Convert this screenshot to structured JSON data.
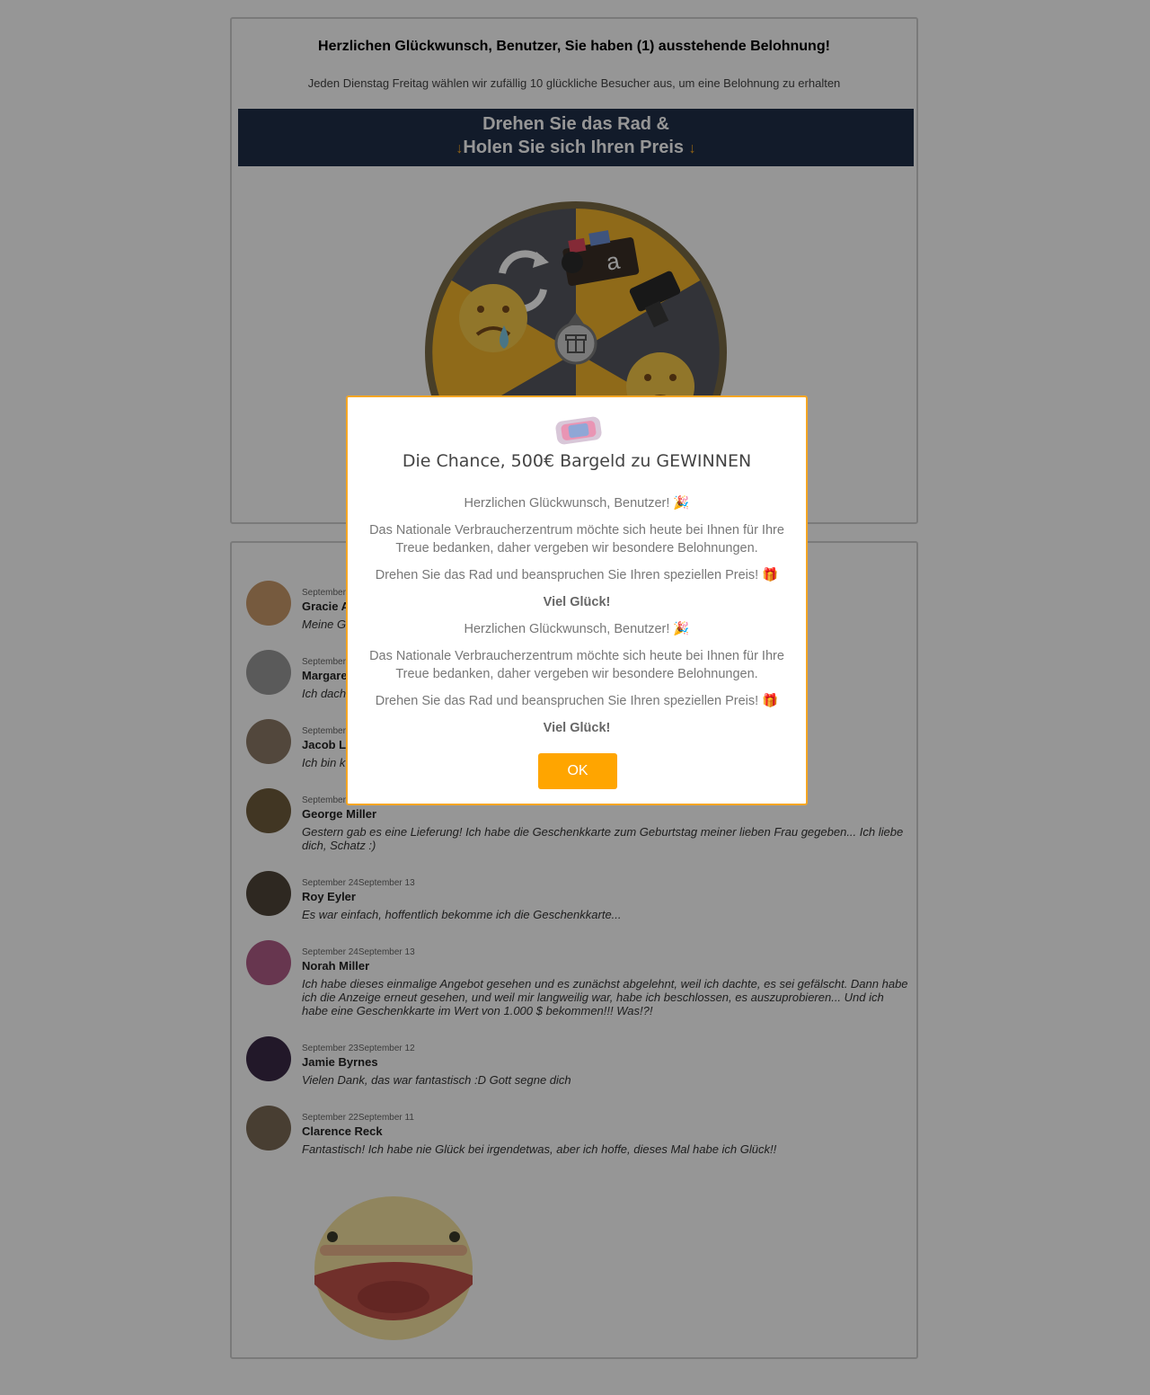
{
  "header": {
    "headline": "Herzlichen Glückwunsch, Benutzer, Sie haben (1) ausstehende Belohnung!",
    "subline": "Jeden Dienstag Freitag wählen wir zufällig 10 glückliche Besucher aus, um eine Belohnung zu erhalten",
    "banner_line1": "Drehen Sie das Rad &",
    "banner_line2": "Holen Sie sich Ihren Preis",
    "banner_arrow": "↓"
  },
  "wheel": {
    "segments": [
      "refresh-icon",
      "amazon-gift-box",
      "camera",
      "sad-emoji",
      "shield",
      "sad-emoji"
    ],
    "colors": {
      "gray": "#55585f",
      "yellow": "#f3b42c",
      "rim": "#7a6a45"
    },
    "center_icon": "gift-icon"
  },
  "comments": [
    {
      "date": "September 24September 13",
      "name": "Gracie A",
      "text": "Meine G",
      "avatar": "#c99a6a"
    },
    {
      "date": "September 24September 13",
      "name": "Margare",
      "text": "Ich dach ... er Post. #echt",
      "avatar": "#9a9a9a"
    },
    {
      "date": "September 24September 13",
      "name": "Jacob L",
      "text": "Ich bin k",
      "avatar": "#8c7a66"
    },
    {
      "date": "September 24September 13",
      "name": "George Miller",
      "text": "Gestern gab es eine Lieferung! Ich habe die Geschenkkarte zum Geburtstag meiner lieben Frau gegeben... Ich liebe dich, Schatz :)",
      "avatar": "#6f5c3c"
    },
    {
      "date": "September 24September 13",
      "name": "Roy Eyler",
      "text": "Es war einfach, hoffentlich bekomme ich die Geschenkkarte...",
      "avatar": "#4e4438"
    },
    {
      "date": "September 24September 13",
      "name": "Norah Miller",
      "text": "Ich habe dieses einmalige Angebot gesehen und es zunächst abgelehnt, weil ich dachte, es sei gefälscht. Dann habe ich die Anzeige erneut gesehen, und weil mir langweilig war, habe ich beschlossen, es auszuprobieren... Und ich habe eine Geschenkkarte im Wert von 1.000 $ bekommen!!! Was!?!",
      "avatar": "#b05c86"
    },
    {
      "date": "September 23September 12",
      "name": "Jamie Byrnes",
      "text": "Vielen Dank, das war fantastisch :D Gott segne dich",
      "avatar": "#3a2a46"
    },
    {
      "date": "September 22September 11",
      "name": "Clarence Reck",
      "text": "Fantastisch! Ich habe nie Glück bei irgendetwas, aber ich hoffe, dieses Mal habe ich Glück!!",
      "avatar": "#7b6a56"
    }
  ],
  "modal": {
    "title": "Die Chance, 500€ Bargeld zu GEWINNEN",
    "para1": "Herzlichen Glückwunsch, Benutzer! 🎉",
    "para2": "Das Nationale Verbraucherzentrum möchte sich heute bei Ihnen für Ihre Treue bedanken, daher vergeben wir besondere Belohnungen.",
    "para3": "Drehen Sie das Rad und beanspruchen Sie Ihren speziellen Preis! 🎁",
    "good_luck": "Viel Glück!",
    "para4": "Herzlichen Glückwunsch, Benutzer! 🎉",
    "para5": "Das Nationale Verbraucherzentrum möchte sich heute bei Ihnen für Ihre Treue bedanken, daher vergeben wir besondere Belohnungen.",
    "para6": "Drehen Sie das Rad und beanspruchen Sie Ihren speziellen Preis! 🎁",
    "good_luck2": "Viel Glück!",
    "ok_label": "OK"
  },
  "colors": {
    "accent": "#ffa500",
    "banner": "#1f2f48",
    "overlay": "rgba(0,0,0,0.41)"
  }
}
